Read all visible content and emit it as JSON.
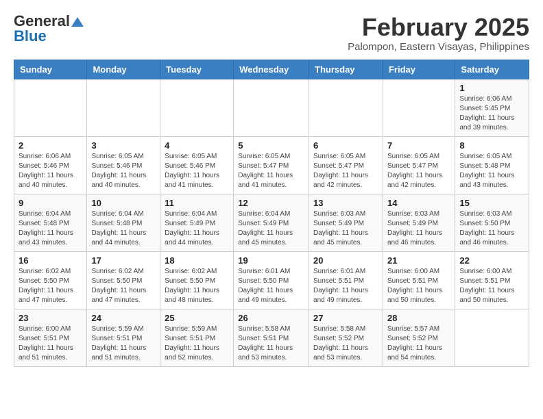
{
  "header": {
    "logo": {
      "line1": "General",
      "line2": "Blue"
    },
    "title": "February 2025",
    "location": "Palompon, Eastern Visayas, Philippines"
  },
  "weekdays": [
    "Sunday",
    "Monday",
    "Tuesday",
    "Wednesday",
    "Thursday",
    "Friday",
    "Saturday"
  ],
  "weeks": [
    [
      {
        "day": "",
        "info": ""
      },
      {
        "day": "",
        "info": ""
      },
      {
        "day": "",
        "info": ""
      },
      {
        "day": "",
        "info": ""
      },
      {
        "day": "",
        "info": ""
      },
      {
        "day": "",
        "info": ""
      },
      {
        "day": "1",
        "info": "Sunrise: 6:06 AM\nSunset: 5:45 PM\nDaylight: 11 hours\nand 39 minutes."
      }
    ],
    [
      {
        "day": "2",
        "info": "Sunrise: 6:06 AM\nSunset: 5:46 PM\nDaylight: 11 hours\nand 40 minutes."
      },
      {
        "day": "3",
        "info": "Sunrise: 6:05 AM\nSunset: 5:46 PM\nDaylight: 11 hours\nand 40 minutes."
      },
      {
        "day": "4",
        "info": "Sunrise: 6:05 AM\nSunset: 5:46 PM\nDaylight: 11 hours\nand 41 minutes."
      },
      {
        "day": "5",
        "info": "Sunrise: 6:05 AM\nSunset: 5:47 PM\nDaylight: 11 hours\nand 41 minutes."
      },
      {
        "day": "6",
        "info": "Sunrise: 6:05 AM\nSunset: 5:47 PM\nDaylight: 11 hours\nand 42 minutes."
      },
      {
        "day": "7",
        "info": "Sunrise: 6:05 AM\nSunset: 5:47 PM\nDaylight: 11 hours\nand 42 minutes."
      },
      {
        "day": "8",
        "info": "Sunrise: 6:05 AM\nSunset: 5:48 PM\nDaylight: 11 hours\nand 43 minutes."
      }
    ],
    [
      {
        "day": "9",
        "info": "Sunrise: 6:04 AM\nSunset: 5:48 PM\nDaylight: 11 hours\nand 43 minutes."
      },
      {
        "day": "10",
        "info": "Sunrise: 6:04 AM\nSunset: 5:48 PM\nDaylight: 11 hours\nand 44 minutes."
      },
      {
        "day": "11",
        "info": "Sunrise: 6:04 AM\nSunset: 5:49 PM\nDaylight: 11 hours\nand 44 minutes."
      },
      {
        "day": "12",
        "info": "Sunrise: 6:04 AM\nSunset: 5:49 PM\nDaylight: 11 hours\nand 45 minutes."
      },
      {
        "day": "13",
        "info": "Sunrise: 6:03 AM\nSunset: 5:49 PM\nDaylight: 11 hours\nand 45 minutes."
      },
      {
        "day": "14",
        "info": "Sunrise: 6:03 AM\nSunset: 5:49 PM\nDaylight: 11 hours\nand 46 minutes."
      },
      {
        "day": "15",
        "info": "Sunrise: 6:03 AM\nSunset: 5:50 PM\nDaylight: 11 hours\nand 46 minutes."
      }
    ],
    [
      {
        "day": "16",
        "info": "Sunrise: 6:02 AM\nSunset: 5:50 PM\nDaylight: 11 hours\nand 47 minutes."
      },
      {
        "day": "17",
        "info": "Sunrise: 6:02 AM\nSunset: 5:50 PM\nDaylight: 11 hours\nand 47 minutes."
      },
      {
        "day": "18",
        "info": "Sunrise: 6:02 AM\nSunset: 5:50 PM\nDaylight: 11 hours\nand 48 minutes."
      },
      {
        "day": "19",
        "info": "Sunrise: 6:01 AM\nSunset: 5:50 PM\nDaylight: 11 hours\nand 49 minutes."
      },
      {
        "day": "20",
        "info": "Sunrise: 6:01 AM\nSunset: 5:51 PM\nDaylight: 11 hours\nand 49 minutes."
      },
      {
        "day": "21",
        "info": "Sunrise: 6:00 AM\nSunset: 5:51 PM\nDaylight: 11 hours\nand 50 minutes."
      },
      {
        "day": "22",
        "info": "Sunrise: 6:00 AM\nSunset: 5:51 PM\nDaylight: 11 hours\nand 50 minutes."
      }
    ],
    [
      {
        "day": "23",
        "info": "Sunrise: 6:00 AM\nSunset: 5:51 PM\nDaylight: 11 hours\nand 51 minutes."
      },
      {
        "day": "24",
        "info": "Sunrise: 5:59 AM\nSunset: 5:51 PM\nDaylight: 11 hours\nand 51 minutes."
      },
      {
        "day": "25",
        "info": "Sunrise: 5:59 AM\nSunset: 5:51 PM\nDaylight: 11 hours\nand 52 minutes."
      },
      {
        "day": "26",
        "info": "Sunrise: 5:58 AM\nSunset: 5:51 PM\nDaylight: 11 hours\nand 53 minutes."
      },
      {
        "day": "27",
        "info": "Sunrise: 5:58 AM\nSunset: 5:52 PM\nDaylight: 11 hours\nand 53 minutes."
      },
      {
        "day": "28",
        "info": "Sunrise: 5:57 AM\nSunset: 5:52 PM\nDaylight: 11 hours\nand 54 minutes."
      },
      {
        "day": "",
        "info": ""
      }
    ]
  ]
}
